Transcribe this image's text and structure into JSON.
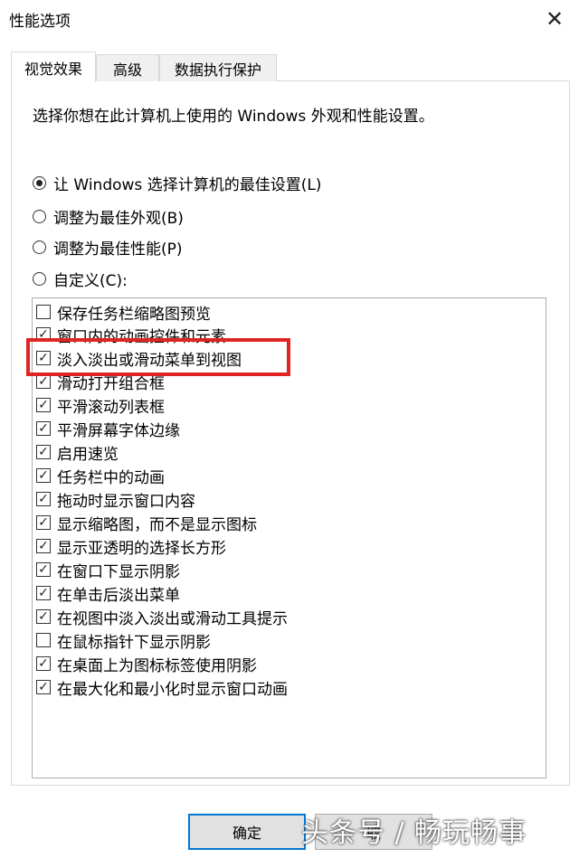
{
  "window": {
    "title": "性能选项"
  },
  "tabs": [
    {
      "label": "视觉效果",
      "active": true
    },
    {
      "label": "高级",
      "active": false
    },
    {
      "label": "数据执行保护",
      "active": false
    }
  ],
  "description": "选择你想在此计算机上使用的 Windows 外观和性能设置。",
  "options": [
    {
      "label": "让 Windows 选择计算机的最佳设置(L)",
      "selected": true
    },
    {
      "label": "调整为最佳外观(B)",
      "selected": false
    },
    {
      "label": "调整为最佳性能(P)",
      "selected": false
    },
    {
      "label": "自定义(C):",
      "selected": false
    }
  ],
  "effects": [
    {
      "label": "保存任务栏缩略图预览",
      "checked": false
    },
    {
      "label": "窗口内的动画控件和元素",
      "checked": true
    },
    {
      "label": "淡入淡出或滑动菜单到视图",
      "checked": true
    },
    {
      "label": "滑动打开组合框",
      "checked": true
    },
    {
      "label": "平滑滚动列表框",
      "checked": true
    },
    {
      "label": "平滑屏幕字体边缘",
      "checked": true
    },
    {
      "label": "启用速览",
      "checked": true
    },
    {
      "label": "任务栏中的动画",
      "checked": true
    },
    {
      "label": "拖动时显示窗口内容",
      "checked": true
    },
    {
      "label": "显示缩略图，而不是显示图标",
      "checked": true
    },
    {
      "label": "显示亚透明的选择长方形",
      "checked": true
    },
    {
      "label": "在窗口下显示阴影",
      "checked": true
    },
    {
      "label": "在单击后淡出菜单",
      "checked": true
    },
    {
      "label": "在视图中淡入淡出或滑动工具提示",
      "checked": true
    },
    {
      "label": "在鼠标指针下显示阴影",
      "checked": false
    },
    {
      "label": "在桌面上为图标标签使用阴影",
      "checked": true
    },
    {
      "label": "在最大化和最小化时显示窗口动画",
      "checked": true
    }
  ],
  "buttons": {
    "ok": "确定",
    "cancel": "取"
  },
  "watermark": "头条号 / 畅玩畅事",
  "colors": {
    "highlight": "#e02424",
    "accent": "#0078d7"
  }
}
